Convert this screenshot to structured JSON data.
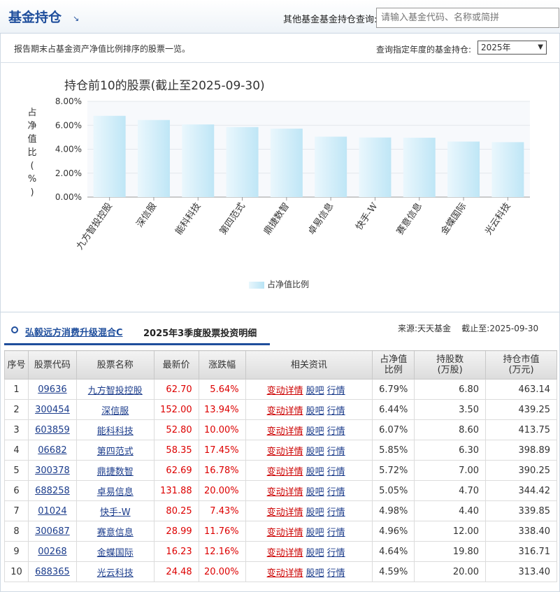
{
  "header": {
    "title": "基金持仓",
    "arrow": "↘",
    "search_label": "其他基金基金持仓查询:",
    "search_placeholder": "请输入基金代码、名称或简拼"
  },
  "subbar": {
    "description": "报告期末占基金资产净值比例排序的股票一览。",
    "year_label": "查询指定年度的基金持仓:",
    "year_value": "2025年"
  },
  "chart_data": {
    "type": "bar",
    "title": "持仓前10的股票(截止至2025-09-30)",
    "ylabel": "占净值比(%)",
    "ylim": [
      0,
      8
    ],
    "yticks": [
      "0.00%",
      "2.00%",
      "4.00%",
      "6.00%",
      "8.00%"
    ],
    "categories": [
      "九方智投控股",
      "深信服",
      "能科科技",
      "第四范式",
      "鼎捷数智",
      "卓易信息",
      "快手-W",
      "赛意信息",
      "金蝶国际",
      "光云科技"
    ],
    "values": [
      6.79,
      6.44,
      6.07,
      5.85,
      5.72,
      5.05,
      4.98,
      4.96,
      4.64,
      4.59
    ],
    "legend": "占净值比例",
    "grid": true,
    "bar_color": "#bfe6f6"
  },
  "section": {
    "fund_name": "弘毅远方消费升级混合C",
    "title": "2025年3季度股票投资明细",
    "source": "来源:天天基金    截止至:2025-09-30"
  },
  "table": {
    "headers": {
      "seq": "序号",
      "code": "股票代码",
      "name": "股票名称",
      "price": "最新价",
      "change": "涨跌幅",
      "news": "相关资讯",
      "ratio": "占净值\n比例",
      "shares": "持股数\n(万股)",
      "value": "持仓市值\n(万元)"
    },
    "news_links": [
      "变动详情",
      "股吧",
      "行情"
    ],
    "rows": [
      {
        "seq": "1",
        "code": "09636",
        "name": "九方智投控股",
        "price": "62.70",
        "change": "5.64%",
        "ratio": "6.79%",
        "shares": "6.80",
        "value": "463.14"
      },
      {
        "seq": "2",
        "code": "300454",
        "name": "深信服",
        "price": "152.00",
        "change": "13.94%",
        "ratio": "6.44%",
        "shares": "3.50",
        "value": "439.25"
      },
      {
        "seq": "3",
        "code": "603859",
        "name": "能科科技",
        "price": "52.80",
        "change": "10.00%",
        "ratio": "6.07%",
        "shares": "8.60",
        "value": "413.75"
      },
      {
        "seq": "4",
        "code": "06682",
        "name": "第四范式",
        "price": "58.35",
        "change": "17.45%",
        "ratio": "5.85%",
        "shares": "6.30",
        "value": "398.89"
      },
      {
        "seq": "5",
        "code": "300378",
        "name": "鼎捷数智",
        "price": "62.69",
        "change": "16.78%",
        "ratio": "5.72%",
        "shares": "7.00",
        "value": "390.25"
      },
      {
        "seq": "6",
        "code": "688258",
        "name": "卓易信息",
        "price": "131.88",
        "change": "20.00%",
        "ratio": "5.05%",
        "shares": "4.70",
        "value": "344.42"
      },
      {
        "seq": "7",
        "code": "01024",
        "name": "快手-W",
        "price": "80.25",
        "change": "7.43%",
        "ratio": "4.98%",
        "shares": "4.40",
        "value": "339.85"
      },
      {
        "seq": "8",
        "code": "300687",
        "name": "赛意信息",
        "price": "28.99",
        "change": "11.76%",
        "ratio": "4.96%",
        "shares": "12.00",
        "value": "338.40"
      },
      {
        "seq": "9",
        "code": "00268",
        "name": "金蝶国际",
        "price": "16.23",
        "change": "12.16%",
        "ratio": "4.64%",
        "shares": "19.80",
        "value": "316.71"
      },
      {
        "seq": "10",
        "code": "688365",
        "name": "光云科技",
        "price": "24.48",
        "change": "20.00%",
        "ratio": "4.59%",
        "shares": "20.00",
        "value": "313.40"
      }
    ]
  }
}
